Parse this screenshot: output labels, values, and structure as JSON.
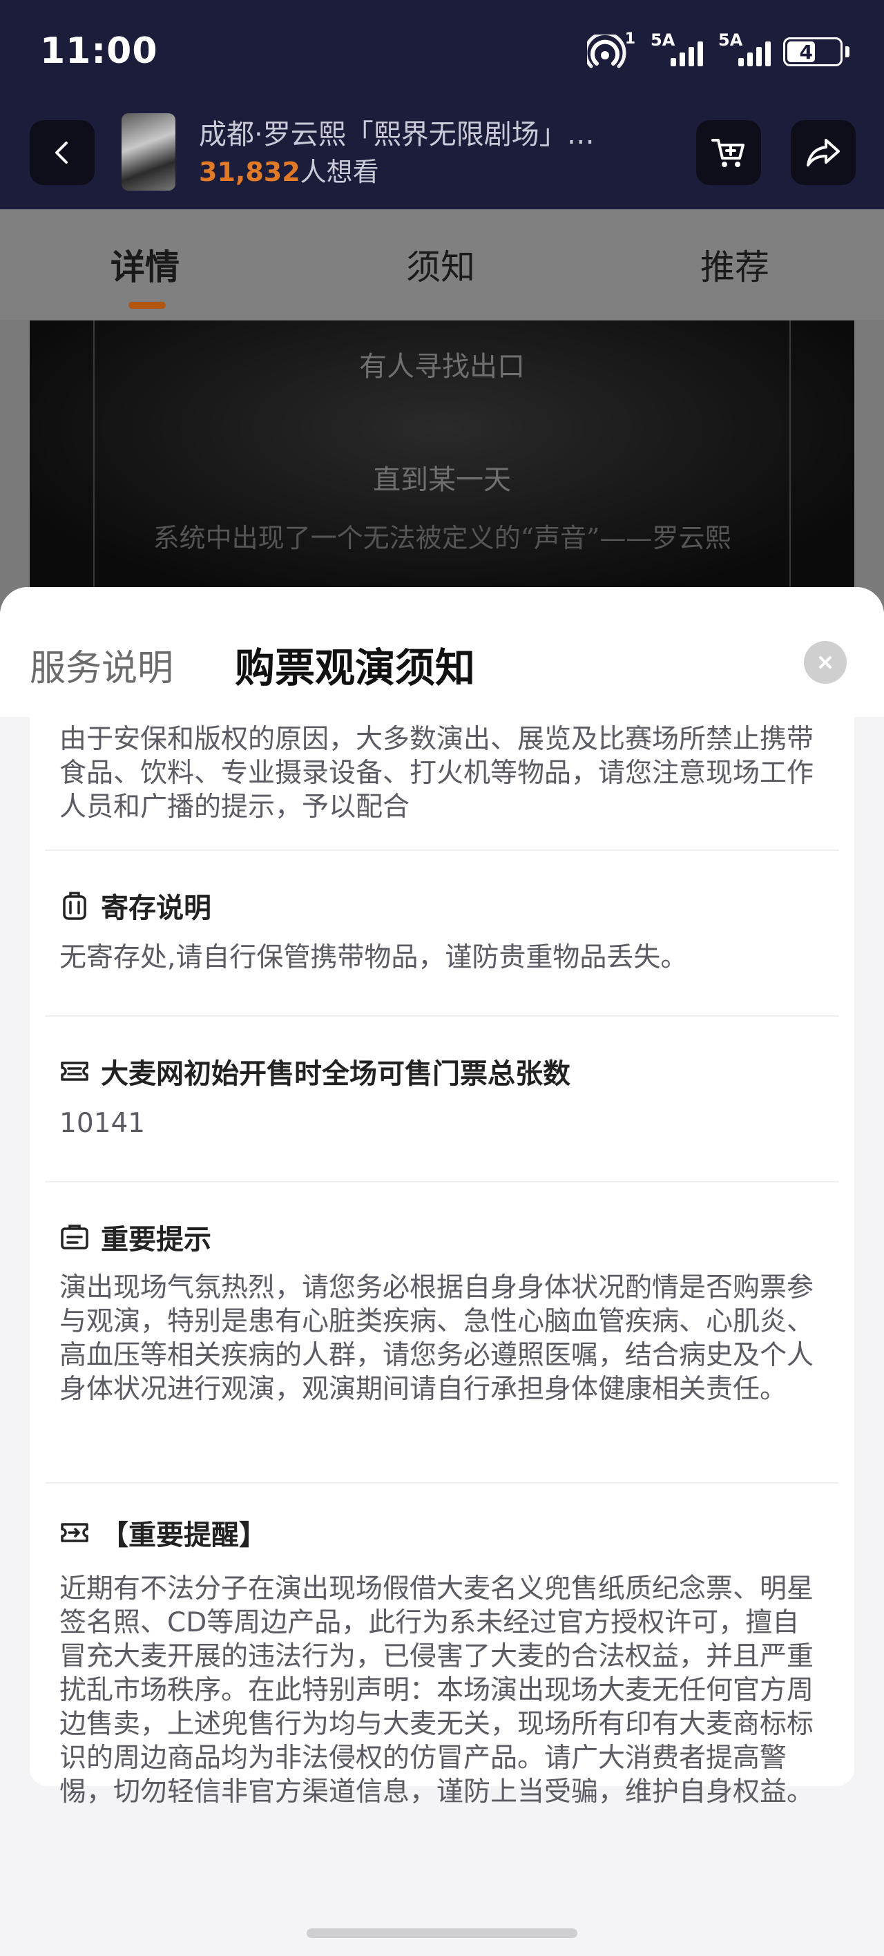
{
  "status_bar": {
    "time": "11:00",
    "hotspot_count": "1",
    "sim1": "5A",
    "sim2": "5A",
    "battery": "41"
  },
  "nav": {
    "title": "成都·罗云熙「熙界无限剧场」…",
    "want_count": "31,832",
    "want_suffix": "人想看"
  },
  "tabs": [
    "详情",
    "须知",
    "推荐"
  ],
  "banner": {
    "line1": "有人寻找出口",
    "line2": "直到某一天",
    "line3": "系统中出现了一个无法被定义的“声音”——罗云熙"
  },
  "sheet": {
    "tab_service": "服务说明",
    "tab_notice": "购票观演须知"
  },
  "sections": {
    "intro_text": "由于安保和版权的原因，大多数演出、展览及比赛场所禁止携带食品、饮料、专业摄录设备、打火机等物品，请您注意现场工作人员和广播的提示，予以配合",
    "storage": {
      "title": "寄存说明",
      "text": "无寄存处,请自行保管携带物品，谨防贵重物品丢失。"
    },
    "tickets": {
      "title": "大麦网初始开售时全场可售门票总张数",
      "text": "10141"
    },
    "important": {
      "title": "重要提示",
      "text": "演出现场气氛热烈，请您务必根据自身身体状况酌情是否购票参与观演，特别是患有心脏类疾病、急性心脑血管疾病、心肌炎、高血压等相关疾病的人群，请您务必遵照医嘱，结合病史及个人身体状况进行观演，观演期间请自行承担身体健康相关责任。"
    },
    "reminder": {
      "title": "【重要提醒】",
      "text": "近期有不法分子在演出现场假借大麦名义兜售纸质纪念票、明星签名照、CD等周边产品，此行为系未经过官方授权许可，擅自冒充大麦开展的违法行为，已侵害了大麦的合法权益，并且严重扰乱市场秩序。在此特别声明：本场演出现场大麦无任何官方周边售卖，上述兜售行为均与大麦无关，现场所有印有大麦商标标识的周边商品均为非法侵权的仿冒产品。请广大消费者提高警惕，切勿轻信非官方渠道信息，谨防上当受骗，维护自身权益。"
    }
  },
  "colors": {
    "header_bg": "#1c1d3a",
    "accent_orange": "#e07a26",
    "tab_underline": "#b2560f"
  },
  "icons": [
    "back-icon",
    "cart-icon",
    "share-icon",
    "close-icon",
    "luggage-icon",
    "ticket-icon",
    "clipboard-icon",
    "ticket-arrow-icon"
  ]
}
